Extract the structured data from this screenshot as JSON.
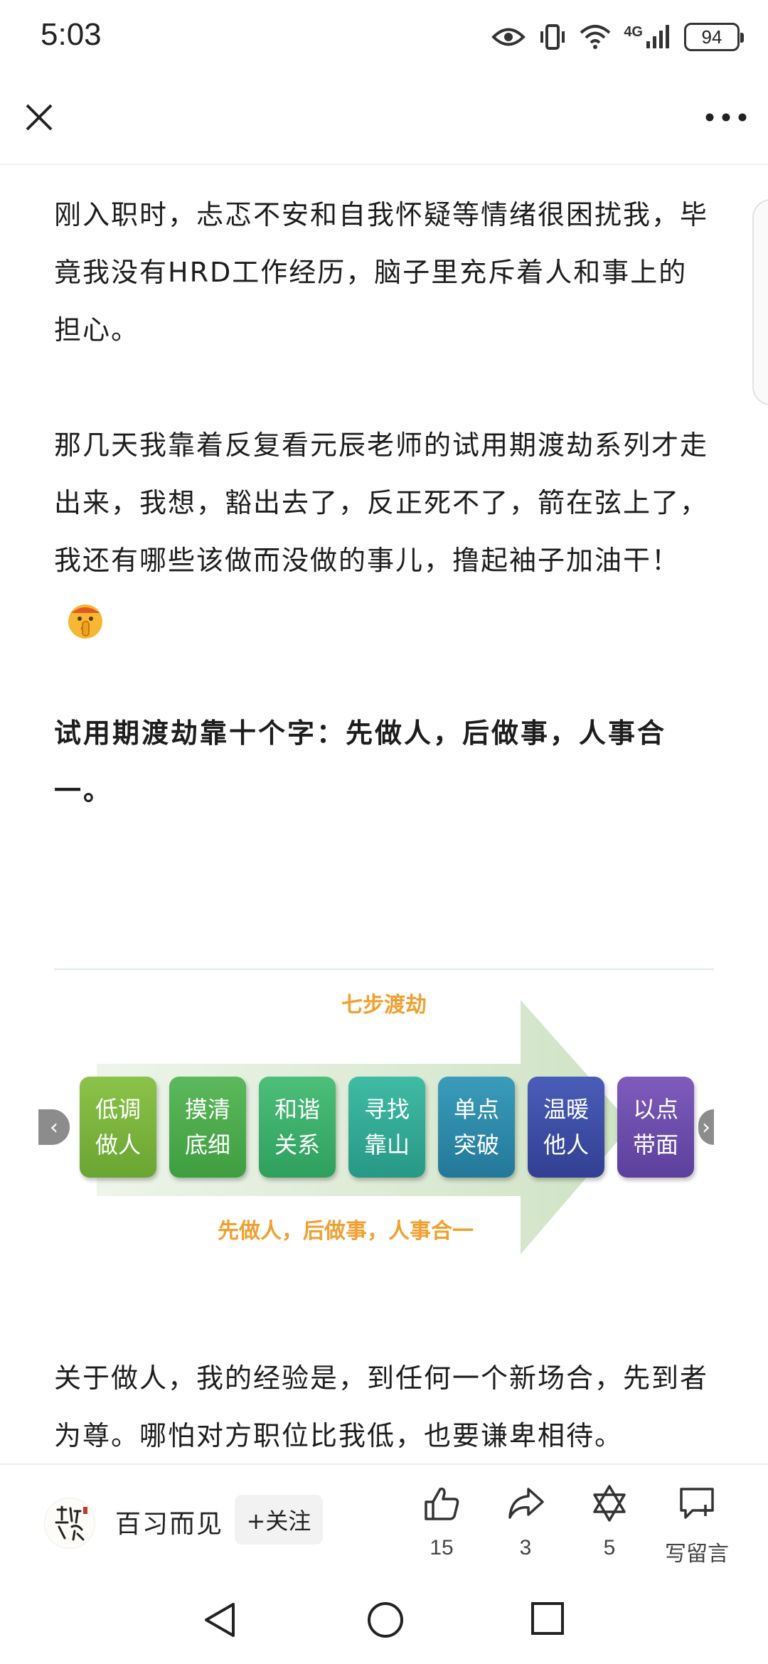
{
  "status_bar": {
    "time": "5:03",
    "network": "4G",
    "battery": "94",
    "icons": [
      "eye-icon",
      "vibrate-icon",
      "wifi-icon",
      "signal-icon",
      "battery-icon"
    ]
  },
  "nav": {
    "close_icon": "close-icon",
    "more_icon": "more-dots-icon"
  },
  "article": {
    "paragraphs": [
      "刚入职时，忐忑不安和自我怀疑等情绪很困扰我，毕竟我没有HRD工作经历，脑子里充斥着人和事上的担心。",
      "那几天我靠着反复看元辰老师的试用期渡劫系列才走出来，我想，豁出去了，反正死不了，箭在弦上了，我还有哪些该做而没做的事儿，撸起袖子加油干！",
      "试用期渡劫靠十个字：先做人，后做事，人事合一。",
      "关于做人，我的经验是，到任何一个新场合，先到者为尊。哪怕对方职位比我低，也要谦卑相待。"
    ],
    "emoji": "shushing-face-emoji"
  },
  "infographic": {
    "title": "七步渡劫",
    "subtitle": "先做人，后做事，人事合一",
    "steps": [
      {
        "line1": "低调",
        "line2": "做人",
        "color": "#7cb342"
      },
      {
        "line1": "摸清",
        "line2": "底细",
        "color": "#4caf50"
      },
      {
        "line1": "和谐",
        "line2": "关系",
        "color": "#3fae6a"
      },
      {
        "line1": "寻找",
        "line2": "靠山",
        "color": "#2faa94"
      },
      {
        "line1": "单点",
        "line2": "突破",
        "color": "#2f8ea8"
      },
      {
        "line1": "温暖",
        "line2": "他人",
        "color": "#3f4fa0"
      },
      {
        "line1": "以点",
        "line2": "带面",
        "color": "#6a4fa8"
      }
    ],
    "prev_arrow": "‹",
    "next_arrow": "›"
  },
  "bottom_bar": {
    "author_name": "百习而见",
    "follow_label": "+关注",
    "like_count": "15",
    "share_count": "3",
    "favorite_count": "5",
    "comment_label": "写留言"
  },
  "colors": {
    "accent_orange": "#f0a030",
    "arrow_green": "#dcebd3"
  }
}
